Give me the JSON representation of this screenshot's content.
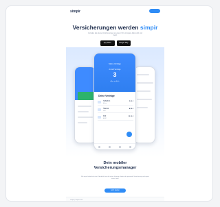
{
  "header": {
    "logo": "simpir",
    "cta_label": ""
  },
  "hero": {
    "title_main": "Versicherungen werden ",
    "title_accent": "simpir",
    "subtitle": "Verwalte alle deine Versicherungen an einem Ort und spare dabei Zeit und Geld.",
    "app_store_label": "App Store",
    "google_play_label": "Google Play"
  },
  "phone": {
    "title": "Meine Verträge",
    "count_label": "Anzahl Verträge",
    "count": "3",
    "count_footer": "Alles im Blick",
    "section_title": "Deine Verträge",
    "contracts": [
      {
        "name": "Haftpflicht",
        "sub": "Allianz",
        "price": "5,90 €"
      },
      {
        "name": "Hausrat",
        "sub": "HUK",
        "price": "4,50 €"
      },
      {
        "name": "KFZ",
        "sub": "ADAC",
        "price": "32,10 €"
      }
    ]
  },
  "section2": {
    "title_line1": "Dein mobiler",
    "title_line2": "Versicherungsmanager",
    "text": "Mit simpir behältst du den Überblick über alle deine Verträge, findest die passende Versicherung und sparst bares Geld.",
    "button_label": "Jetzt starten"
  },
  "footer": {
    "text": "simpir | Impressum"
  },
  "colors": {
    "accent": "#2f8cf6",
    "dark": "#1b2a4a",
    "green": "#2db36b"
  }
}
